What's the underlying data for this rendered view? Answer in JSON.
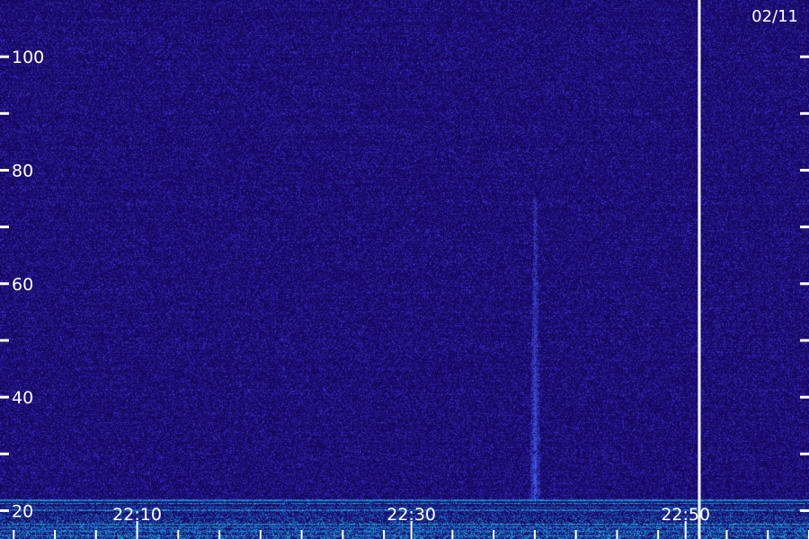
{
  "chart_data": {
    "type": "heatmap",
    "title": "",
    "xlabel": "",
    "ylabel": "",
    "date_label": "02/11",
    "x_range": [
      "22:00",
      "22:59"
    ],
    "y_range": [
      15,
      110
    ],
    "y_ticks": [
      {
        "value": 100,
        "label": "100"
      },
      {
        "value": 80,
        "label": "80"
      },
      {
        "value": 60,
        "label": "60"
      },
      {
        "value": 40,
        "label": "40"
      },
      {
        "value": 20,
        "label": "20"
      }
    ],
    "y_minor_ticks": [
      30,
      50,
      70,
      90
    ],
    "x_ticks": [
      {
        "value": "22:10",
        "label": "22:10"
      },
      {
        "value": "22:30",
        "label": "22:30"
      },
      {
        "value": "22:50",
        "label": "22:50"
      }
    ],
    "x_minor_ticks": [
      "22:01",
      "22:04",
      "22:07",
      "22:13",
      "22:16",
      "22:19",
      "22:22",
      "22:25",
      "22:28",
      "22:33",
      "22:36",
      "22:39",
      "22:42",
      "22:45",
      "22:48",
      "22:53",
      "22:56",
      "22:59"
    ],
    "features": [
      {
        "kind": "meteor_echo",
        "time": "22:39",
        "frequency_range": [
          22,
          75
        ]
      },
      {
        "kind": "marker_line",
        "time": "22:51"
      },
      {
        "kind": "interference_band",
        "frequency_range": [
          15,
          22
        ]
      }
    ],
    "colors": {
      "background": "#16065a",
      "noise_low": "#1a0a6e",
      "noise_high": "#3a30c8",
      "echo": "#3f5cf0",
      "interference_low": "#1b8fe0",
      "interference_high": "#2af07a",
      "axis": "#ffffff"
    }
  }
}
